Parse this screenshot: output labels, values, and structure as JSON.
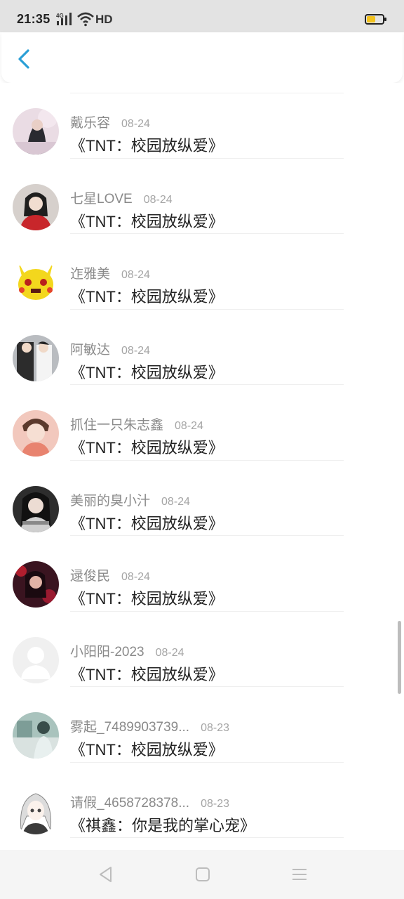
{
  "status_bar": {
    "time": "21:35",
    "network": "4G",
    "hd": "HD",
    "battery_level": 0.6
  },
  "header": {
    "back_icon": "chevron-left-icon",
    "accent_color": "#2a9fd6"
  },
  "entries": [
    {
      "user": "戴乐容",
      "date": "08-24",
      "book": "《TNT：校园放纵爱》",
      "avatar": "photo-girl-pink"
    },
    {
      "user": "七星LOVE",
      "date": "08-24",
      "book": "《TNT：校园放纵爱》",
      "avatar": "photo-red-outfit"
    },
    {
      "user": "迮雅美",
      "date": "08-24",
      "book": "《TNT：校园放纵爱》",
      "avatar": "pikachu-angry"
    },
    {
      "user": "阿敏达",
      "date": "08-24",
      "book": "《TNT：校园放纵爱》",
      "avatar": "photo-couple"
    },
    {
      "user": "抓住一只朱志鑫",
      "date": "08-24",
      "book": "《TNT：校园放纵爱》",
      "avatar": "photo-boy-peach"
    },
    {
      "user": "美丽的臭小汁",
      "date": "08-24",
      "book": "《TNT：校园放纵爱》",
      "avatar": "photo-girl-dark"
    },
    {
      "user": "逯俊民",
      "date": "08-24",
      "book": "《TNT：校园放纵爱》",
      "avatar": "photo-red-night"
    },
    {
      "user": "小阳阳-2023",
      "date": "08-24",
      "book": "《TNT：校园放纵爱》",
      "avatar": "default-avatar"
    },
    {
      "user": "雾起_7489903739...",
      "date": "08-23",
      "book": "《TNT：校园放纵爱》",
      "avatar": "photo-teal-room"
    },
    {
      "user": "请假_4658728378...",
      "date": "08-23",
      "book": "《祺鑫：你是我的掌心宠》",
      "avatar": "anime-white-hair"
    }
  ],
  "nav_bar": {
    "back": "triangle-back-icon",
    "home": "square-home-icon",
    "menu": "menu-lines-icon"
  }
}
